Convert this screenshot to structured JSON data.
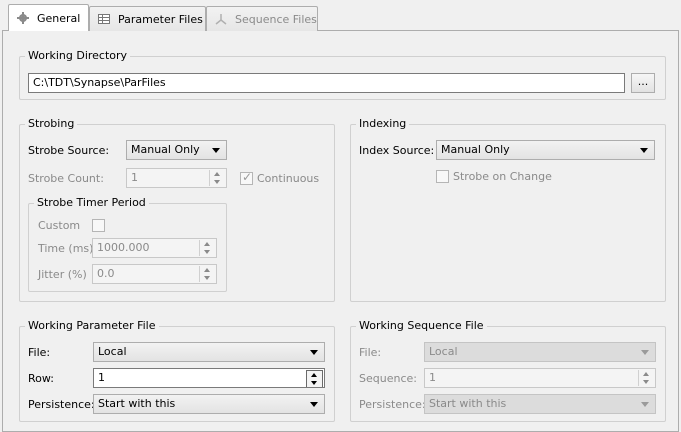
{
  "tabs": [
    {
      "label": "General",
      "icon": "gear-icon",
      "active": true
    },
    {
      "label": "Parameter Files",
      "icon": "table-icon",
      "active": false
    },
    {
      "label": "Sequence Files",
      "icon": "sequence-icon",
      "active": false,
      "disabled": true
    }
  ],
  "working_directory": {
    "title": "Working Directory",
    "path": "C:\\TDT\\Synapse\\ParFiles",
    "browse_label": "..."
  },
  "strobing": {
    "title": "Strobing",
    "source_label": "Strobe Source:",
    "source_value": "Manual Only",
    "count_label": "Strobe Count:",
    "count_value": "1",
    "continuous_label": "Continuous",
    "timer": {
      "title": "Strobe Timer Period",
      "custom_label": "Custom",
      "time_label": "Time (ms)",
      "time_value": "1000.000",
      "jitter_label": "Jitter (%)",
      "jitter_value": "0.0"
    }
  },
  "indexing": {
    "title": "Indexing",
    "source_label": "Index Source:",
    "source_value": "Manual Only",
    "strobe_on_change_label": "Strobe on Change"
  },
  "working_parameter_file": {
    "title": "Working Parameter File",
    "file_label": "File:",
    "file_value": "Local",
    "row_label": "Row:",
    "row_value": "1",
    "persistence_label": "Persistence:",
    "persistence_value": "Start with this"
  },
  "working_sequence_file": {
    "title": "Working Sequence File",
    "file_label": "File:",
    "file_value": "Local",
    "sequence_label": "Sequence:",
    "sequence_value": "1",
    "persistence_label": "Persistence:",
    "persistence_value": "Start with this"
  }
}
